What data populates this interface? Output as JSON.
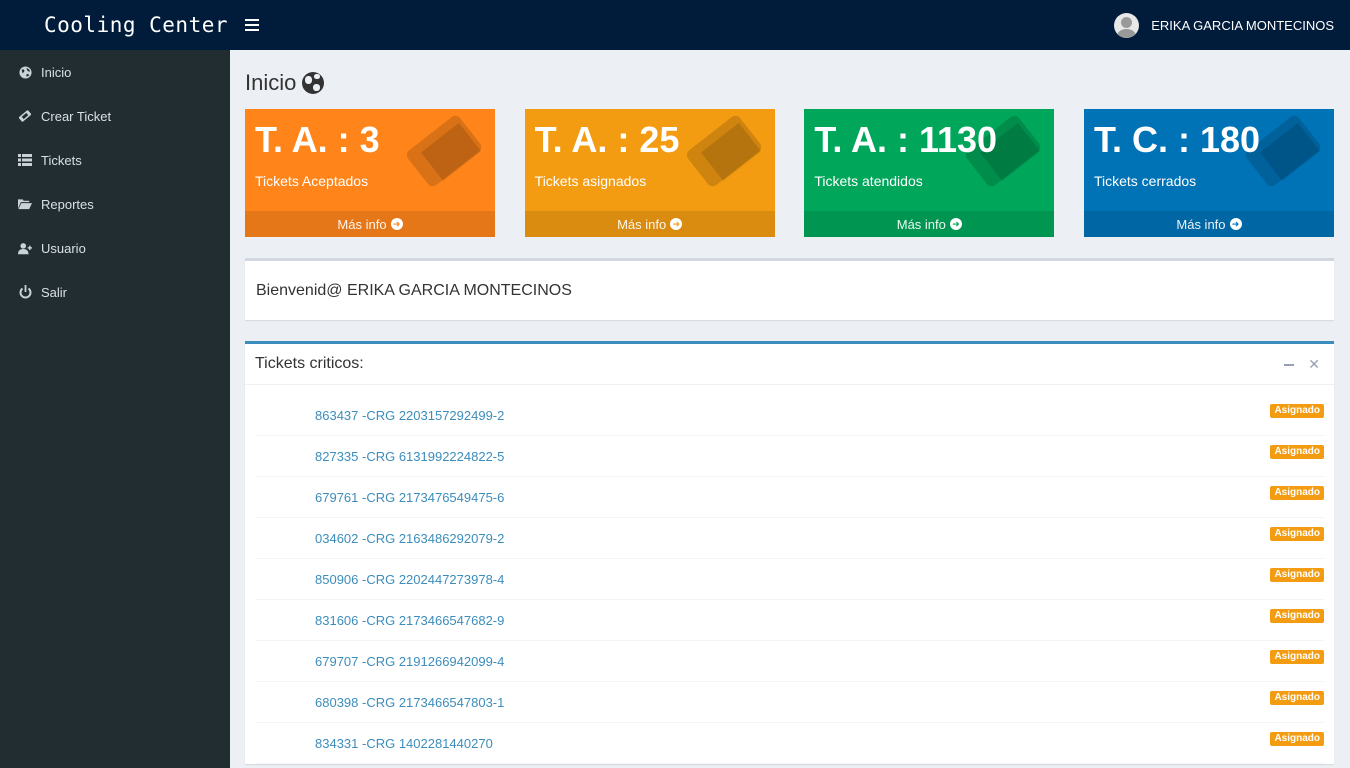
{
  "header": {
    "brand": "Cooling Center",
    "user_name": "ERIKA GARCIA MONTECINOS",
    "bar_color": "#001c3a"
  },
  "sidebar": {
    "items": [
      {
        "label": "Inicio",
        "icon": "globe-icon"
      },
      {
        "label": "Crear Ticket",
        "icon": "ticket-icon"
      },
      {
        "label": "Tickets",
        "icon": "list-icon"
      },
      {
        "label": "Reportes",
        "icon": "folder-open-icon"
      },
      {
        "label": "Usuario",
        "icon": "user-plus-icon"
      },
      {
        "label": "Salir",
        "icon": "power-icon"
      }
    ]
  },
  "page": {
    "title": "Inicio"
  },
  "stat_boxes": [
    {
      "number": "T. A. : 3",
      "caption": "Tickets Aceptados",
      "more": "Más info",
      "color": "#ff851b"
    },
    {
      "number": "T. A. : 25",
      "caption": "Tickets asignados",
      "more": "Más info",
      "color": "#f39c12"
    },
    {
      "number": "T. A. : 1130",
      "caption": "Tickets atendidos",
      "more": "Más info",
      "color": "#00a65a"
    },
    {
      "number": "T. C. : 180",
      "caption": "Tickets cerrados",
      "more": "Más info",
      "color": "#0073b7"
    }
  ],
  "welcome": {
    "text": "Bienvenid@ ERIKA GARCIA MONTECINOS"
  },
  "critical": {
    "title": "Tickets criticos:",
    "rows": [
      {
        "ticket": "863437 -CRG 2203157292499-2",
        "status": "Asignado"
      },
      {
        "ticket": "827335 -CRG 6131992224822-5",
        "status": "Asignado"
      },
      {
        "ticket": "679761 -CRG 2173476549475-6",
        "status": "Asignado"
      },
      {
        "ticket": "034602 -CRG 2163486292079-2",
        "status": "Asignado"
      },
      {
        "ticket": "850906 -CRG 2202447273978-4",
        "status": "Asignado"
      },
      {
        "ticket": "831606 -CRG 2173466547682-9",
        "status": "Asignado"
      },
      {
        "ticket": "679707 -CRG 2191266942099-4",
        "status": "Asignado"
      },
      {
        "ticket": "680398 -CRG 2173466547803-1",
        "status": "Asignado"
      },
      {
        "ticket": "834331 -CRG 1402281440270",
        "status": "Asignado"
      }
    ]
  }
}
